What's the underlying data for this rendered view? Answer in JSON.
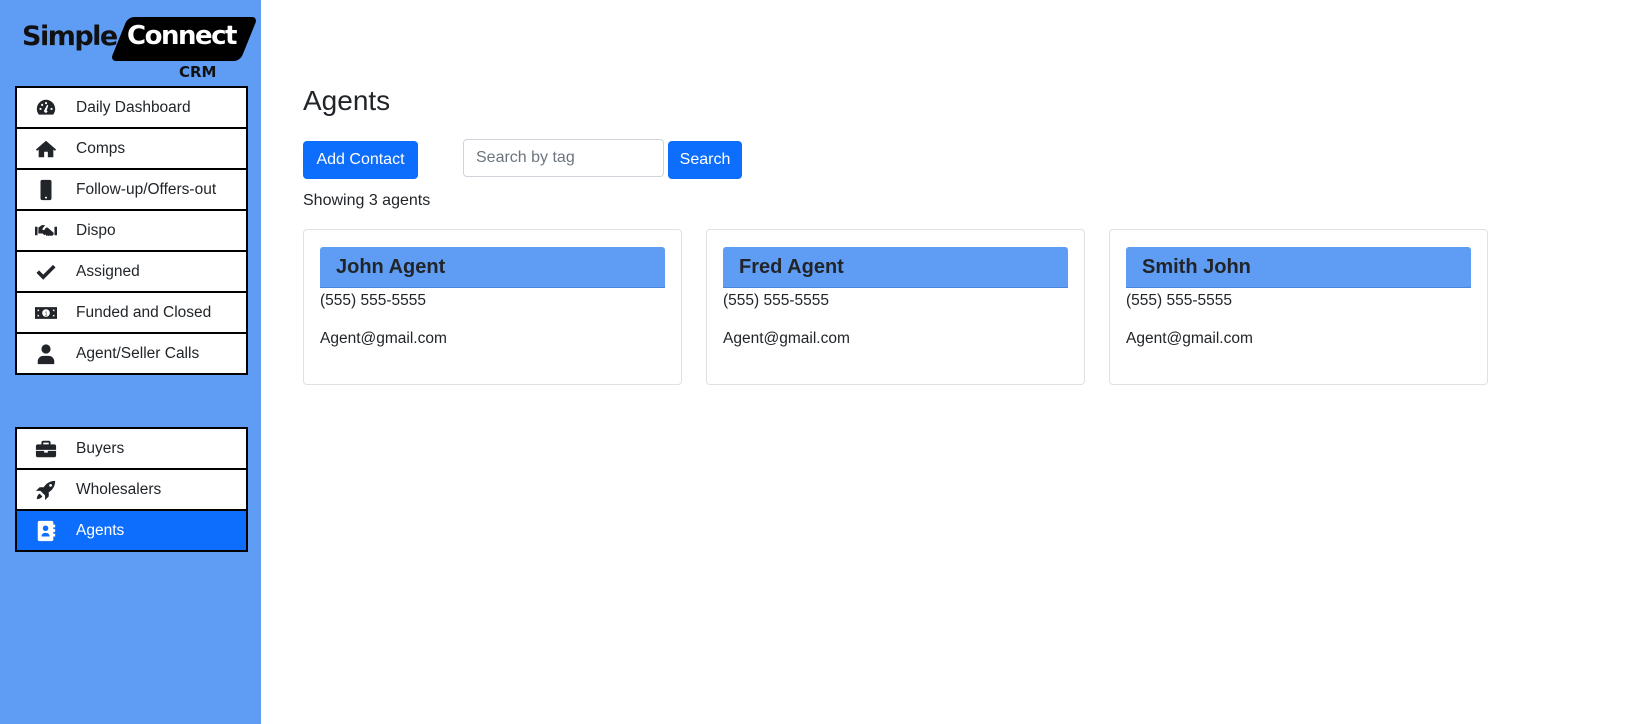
{
  "app": {
    "logo": {
      "word1": "Simple",
      "word2": "Connect",
      "sub": "CRM"
    }
  },
  "sidebar": {
    "groups": [
      {
        "items": [
          {
            "label": "Daily Dashboard",
            "icon": "gauge-icon",
            "active": false
          },
          {
            "label": "Comps",
            "icon": "house-icon",
            "active": false
          },
          {
            "label": "Follow-up/Offers-out",
            "icon": "mobile-phone-icon",
            "active": false
          },
          {
            "label": "Dispo",
            "icon": "handshake-icon",
            "active": false
          },
          {
            "label": "Assigned",
            "icon": "checkmark-icon",
            "active": false
          },
          {
            "label": "Funded and Closed",
            "icon": "money-bill-icon",
            "active": false
          },
          {
            "label": "Agent/Seller Calls",
            "icon": "user-icon",
            "active": false
          }
        ]
      },
      {
        "items": [
          {
            "label": "Buyers",
            "icon": "briefcase-icon",
            "active": false
          },
          {
            "label": "Wholesalers",
            "icon": "rocket-icon",
            "active": false
          },
          {
            "label": "Agents",
            "icon": "address-book-icon",
            "active": true
          }
        ]
      }
    ]
  },
  "main": {
    "title": "Agents",
    "add_contact_label": "Add Contact",
    "search": {
      "placeholder": "Search by tag",
      "value": "",
      "button_label": "Search"
    },
    "showing_text": "Showing 3 agents",
    "agents": [
      {
        "name": "John Agent",
        "phone": "(555) 555-5555",
        "email": "Agent@gmail.com"
      },
      {
        "name": "Fred Agent",
        "phone": "(555) 555-5555",
        "email": "Agent@gmail.com"
      },
      {
        "name": "Smith John",
        "phone": "(555) 555-5555",
        "email": "Agent@gmail.com"
      }
    ]
  },
  "colors": {
    "sidebar_bg": "#5f9cf3",
    "primary": "#0d6efd",
    "card_header": "#5f9cf3"
  }
}
